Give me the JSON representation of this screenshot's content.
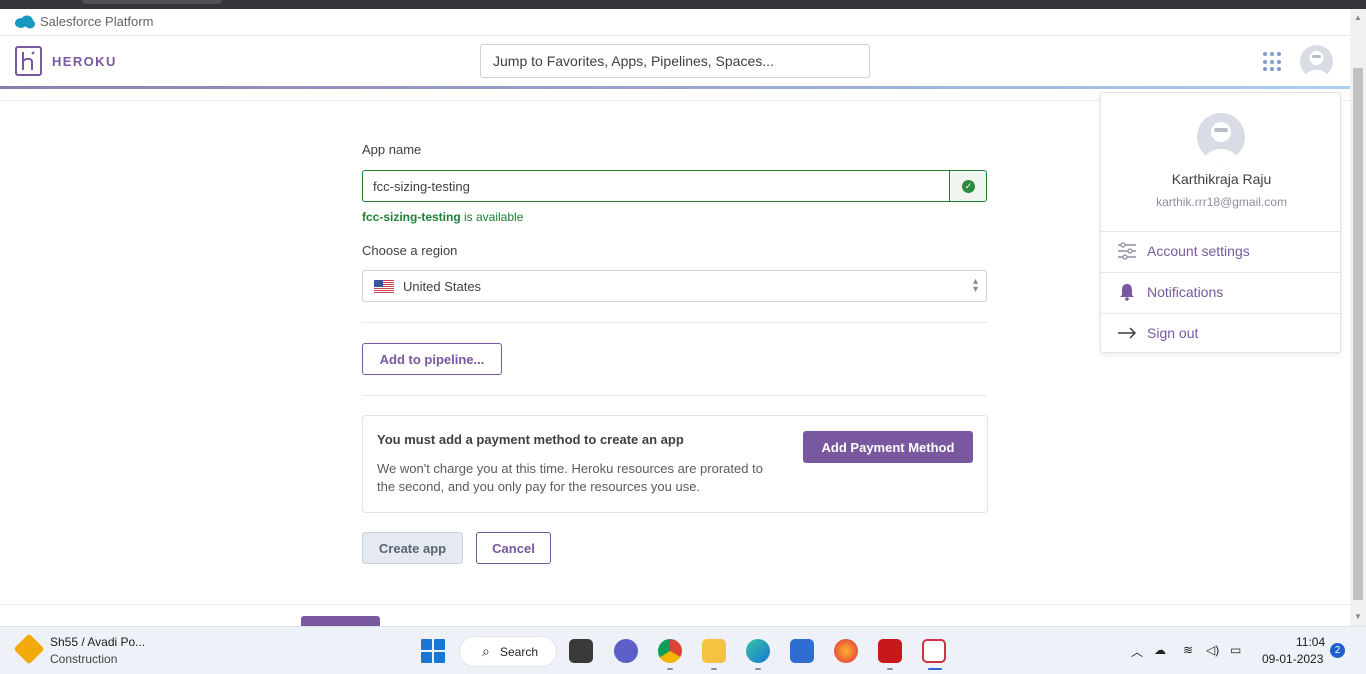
{
  "salesforce_bar": {
    "label": "Salesforce Platform"
  },
  "header": {
    "logo_text": "HEROKU",
    "search_placeholder": "Jump to Favorites, Apps, Pipelines, Spaces...",
    "apps_icon": "grid-icon",
    "avatar_icon": "user-avatar-icon"
  },
  "form": {
    "app_name_label": "App name",
    "app_name_value": "fcc-sizing-testing",
    "availability_name": "fcc-sizing-testing",
    "availability_suffix": " is available",
    "region_label": "Choose a region",
    "region_value": "United States",
    "add_pipeline_label": "Add to pipeline...",
    "payment_title": "You must add a payment method to create an app",
    "payment_desc": "We won't charge you at this time. Heroku resources are prorated to the second, and you only pay for the resources you use.",
    "add_payment_label": "Add Payment Method",
    "create_label": "Create app",
    "cancel_label": "Cancel"
  },
  "account_menu": {
    "name": "Karthikraja Raju",
    "email": "karthik.rrr18@gmail.com",
    "items": [
      {
        "label": "Account settings",
        "icon": "settings-sliders-icon"
      },
      {
        "label": "Notifications",
        "icon": "bell-icon"
      },
      {
        "label": "Sign out",
        "icon": "arrow-right-icon"
      }
    ]
  },
  "taskbar": {
    "weather_title": "Sh55 / Avadi Po...",
    "weather_sub": "Construction",
    "search_label": "Search",
    "time": "11:04",
    "date": "09-01-2023",
    "notification_count": "2"
  },
  "colors": {
    "brand": "#79589f",
    "success": "#1d8034"
  }
}
